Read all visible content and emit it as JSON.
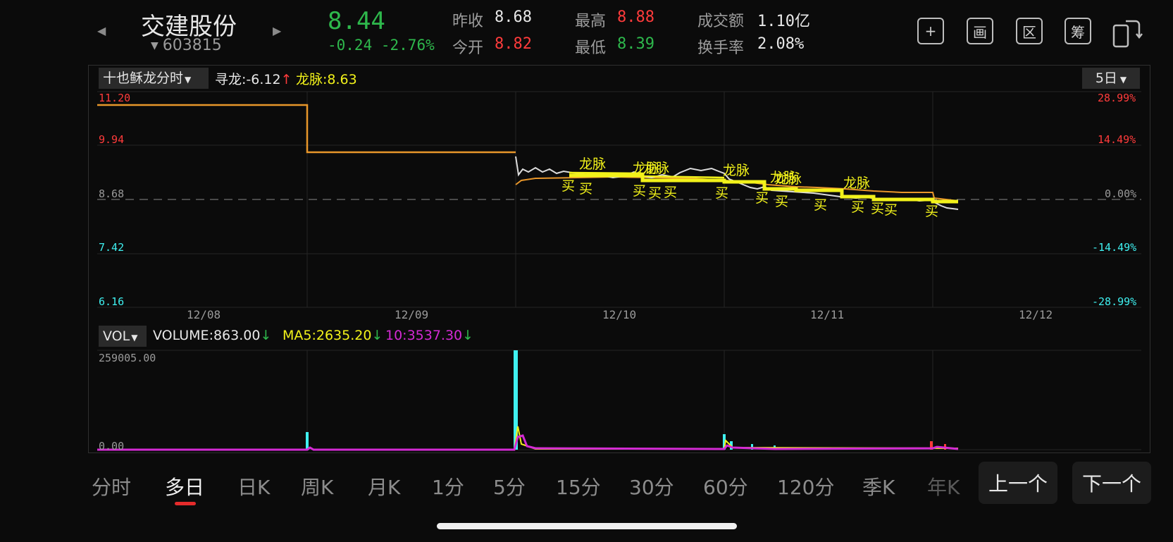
{
  "header": {
    "stock_name": "交建股份",
    "stock_code": "603815",
    "price": "8.44",
    "change": "-0.24",
    "change_pct": "-2.76%",
    "stats": {
      "prev_close_label": "昨收",
      "prev_close": "8.68",
      "open_label": "今开",
      "open": "8.82",
      "high_label": "最高",
      "high": "8.88",
      "low_label": "最低",
      "low": "8.39",
      "turnover_label": "成交额",
      "turnover": "1.10亿",
      "turnover_rate_label": "换手率",
      "turnover_rate": "2.08%"
    },
    "tools": [
      "+",
      "画",
      "区",
      "筹"
    ],
    "tool_icons": [
      "plus-icon",
      "draw-icon",
      "range-icon",
      "chips-icon",
      "rotate-screen-icon"
    ]
  },
  "main_chart": {
    "indicator_name": "十也稣龙分时",
    "period": "5日",
    "xunlong_label": "寻龙:-6.12",
    "longmai_label": "龙脉:8.63",
    "y_left": [
      "11.20",
      "9.94",
      "8.68",
      "7.42",
      "6.16"
    ],
    "y_right": [
      "28.99%",
      "14.49%",
      "0.00%",
      "-14.49%",
      "-28.99%"
    ],
    "x_dates": [
      "12/08",
      "12/09",
      "12/10",
      "12/11",
      "12/12"
    ],
    "signal_buy": "买",
    "signal_longmai": "龙脉"
  },
  "volume_chart": {
    "indicator_name": "VOL",
    "volume_label": "VOLUME:863.00",
    "ma5_label": "MA5:2635.20",
    "ma10_label": "10:3537.30",
    "y_top": "259005.00",
    "y_bottom": "0.00"
  },
  "chart_data": {
    "type": "line",
    "title": "",
    "ylim": [
      6.16,
      11.2
    ],
    "x": [
      "12/08",
      "12/09",
      "12/10",
      "12/11"
    ],
    "series": [
      {
        "name": "",
        "values": [
          11.2,
          9.94,
          8.82,
          8.75
        ]
      }
    ]
  },
  "tabs": [
    "分时",
    "多日",
    "日K",
    "周K",
    "月K",
    "1分",
    "5分",
    "15分",
    "30分",
    "60分",
    "120分",
    "季K",
    "年K"
  ],
  "active_tab": "多日",
  "prev_button": "上一个",
  "next_button": "下一个",
  "colors": {
    "up": "#ff3b3b",
    "down": "#2eb84c",
    "yellow": "#f2f21a",
    "orange": "#e8962a",
    "magenta": "#d42ad4",
    "cyan": "#3ff0f0"
  }
}
